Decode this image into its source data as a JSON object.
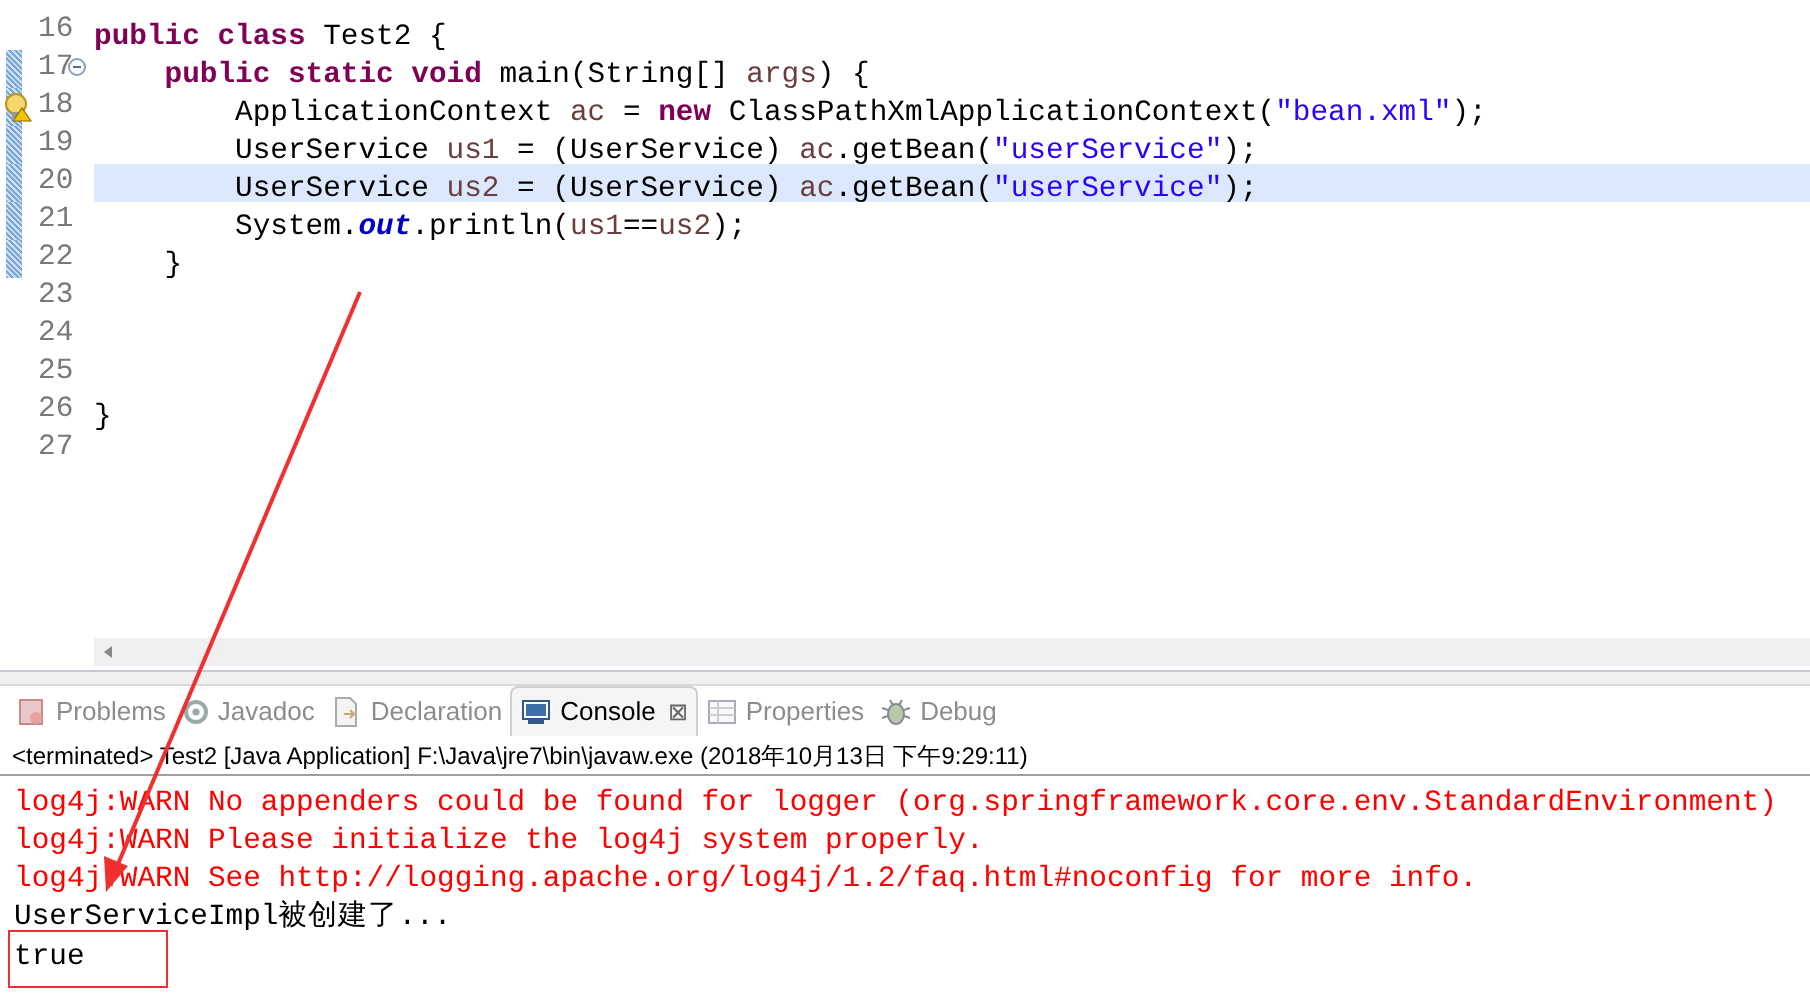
{
  "editor": {
    "lines": [
      {
        "number": "16",
        "highlighted": false,
        "changed": false,
        "foldable": false,
        "warning": false,
        "tokens": [
          {
            "kind": "keyword",
            "text": "public"
          },
          {
            "kind": "keyword",
            "text": " class"
          },
          {
            "kind": "plain",
            "text": " Test2 {"
          }
        ]
      },
      {
        "number": "17",
        "highlighted": false,
        "changed": true,
        "foldable": true,
        "warning": false,
        "tokens": [
          {
            "kind": "keyword",
            "text": "    public"
          },
          {
            "kind": "keyword",
            "text": " static"
          },
          {
            "kind": "keyword",
            "text": " void"
          },
          {
            "kind": "plain",
            "text": " main(String[] "
          },
          {
            "kind": "variable",
            "text": "args"
          },
          {
            "kind": "plain",
            "text": ") {"
          }
        ]
      },
      {
        "number": "18",
        "highlighted": false,
        "changed": true,
        "foldable": false,
        "warning": true,
        "tokens": [
          {
            "kind": "plain",
            "text": "        ApplicationContext "
          },
          {
            "kind": "variable",
            "text": "ac"
          },
          {
            "kind": "plain",
            "text": " = "
          },
          {
            "kind": "keyword",
            "text": "new"
          },
          {
            "kind": "plain",
            "text": " ClassPathXmlApplicationContext("
          },
          {
            "kind": "string",
            "text": "\"bean.xml\""
          },
          {
            "kind": "plain",
            "text": ");"
          }
        ]
      },
      {
        "number": "19",
        "highlighted": false,
        "changed": true,
        "foldable": false,
        "warning": false,
        "tokens": [
          {
            "kind": "plain",
            "text": "        UserService "
          },
          {
            "kind": "variable",
            "text": "us1"
          },
          {
            "kind": "plain",
            "text": " = (UserService) "
          },
          {
            "kind": "variable",
            "text": "ac"
          },
          {
            "kind": "plain",
            "text": ".getBean("
          },
          {
            "kind": "string",
            "text": "\"userService\""
          },
          {
            "kind": "plain",
            "text": ");"
          }
        ]
      },
      {
        "number": "20",
        "highlighted": true,
        "changed": true,
        "foldable": false,
        "warning": false,
        "tokens": [
          {
            "kind": "plain",
            "text": "        UserService "
          },
          {
            "kind": "variable",
            "text": "us2"
          },
          {
            "kind": "plain",
            "text": " = (UserService) "
          },
          {
            "kind": "variable",
            "text": "ac"
          },
          {
            "kind": "plain",
            "text": ".getBean("
          },
          {
            "kind": "string",
            "text": "\"userService\""
          },
          {
            "kind": "plain",
            "text": ");"
          }
        ]
      },
      {
        "number": "21",
        "highlighted": false,
        "changed": true,
        "foldable": false,
        "warning": false,
        "tokens": [
          {
            "kind": "plain",
            "text": "        System."
          },
          {
            "kind": "field",
            "text": "out"
          },
          {
            "kind": "plain",
            "text": ".println("
          },
          {
            "kind": "variable",
            "text": "us1"
          },
          {
            "kind": "plain",
            "text": "=="
          },
          {
            "kind": "variable",
            "text": "us2"
          },
          {
            "kind": "plain",
            "text": ");"
          }
        ]
      },
      {
        "number": "22",
        "highlighted": false,
        "changed": true,
        "foldable": false,
        "warning": false,
        "tokens": [
          {
            "kind": "plain",
            "text": "    }"
          }
        ]
      },
      {
        "number": "23",
        "highlighted": false,
        "changed": false,
        "foldable": false,
        "warning": false
      },
      {
        "number": "24",
        "highlighted": false,
        "changed": false,
        "foldable": false,
        "warning": false
      },
      {
        "number": "25",
        "highlighted": false,
        "changed": false,
        "foldable": false,
        "warning": false
      },
      {
        "number": "26",
        "highlighted": false,
        "changed": false,
        "foldable": false,
        "warning": false,
        "tokens": [
          {
            "kind": "plain",
            "text": "}"
          }
        ]
      },
      {
        "number": "27",
        "highlighted": false,
        "changed": false,
        "foldable": false,
        "warning": false
      }
    ]
  },
  "panel": {
    "tabs": [
      {
        "label": "Problems",
        "kind": "problems",
        "selected": false
      },
      {
        "label": "Javadoc",
        "kind": "javadoc",
        "selected": false
      },
      {
        "label": "Declaration",
        "kind": "declaration",
        "selected": false
      },
      {
        "label": "Console",
        "kind": "console",
        "selected": true,
        "close": "⊠"
      },
      {
        "label": "Properties",
        "kind": "properties",
        "selected": false
      },
      {
        "label": "Debug",
        "kind": "debug",
        "selected": false
      }
    ],
    "status": "<terminated> Test2 [Java Application] F:\\Java\\jre7\\bin\\javaw.exe (2018年10月13日 下午9:29:11)",
    "output": [
      {
        "kind": "error",
        "text": "log4j:WARN No appenders could be found for logger (org.springframework.core.env.StandardEnvironment)",
        "boxed": false
      },
      {
        "kind": "error",
        "text": "log4j:WARN Please initialize the log4j system properly.",
        "boxed": false
      },
      {
        "kind": "error",
        "text": "log4j:WARN See http://logging.apache.org/log4j/1.2/faq.html#noconfig for more info.",
        "boxed": false
      },
      {
        "kind": "out",
        "text": "UserServiceImpl被创建了...",
        "boxed": false
      },
      {
        "kind": "out",
        "text": "true",
        "boxed": true
      }
    ]
  }
}
